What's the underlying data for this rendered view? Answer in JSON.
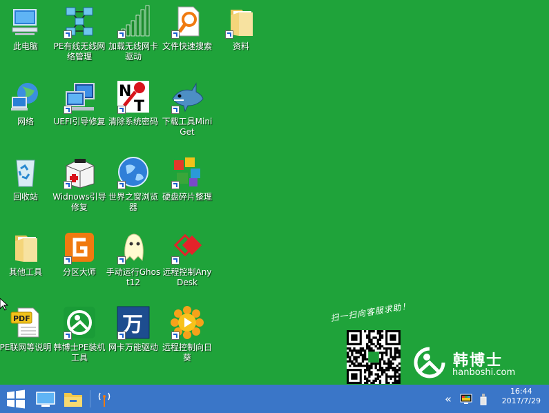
{
  "desktop": {
    "icons": [
      {
        "label": "此电脑",
        "icon": "computer-icon",
        "shortcut": false
      },
      {
        "label": "PE有线无线网络管理",
        "icon": "network-manager-icon",
        "shortcut": true
      },
      {
        "label": "加载无线网卡驱动",
        "icon": "wireless-signal-icon",
        "shortcut": true
      },
      {
        "label": "文件快速搜索",
        "icon": "file-search-icon",
        "shortcut": true
      },
      {
        "label": "资料",
        "icon": "folder-icon",
        "shortcut": true
      },
      {
        "label": "网络",
        "icon": "network-globe-icon",
        "shortcut": false
      },
      {
        "label": "UEFI引导修复",
        "icon": "uefi-repair-icon",
        "shortcut": true
      },
      {
        "label": "清除系统密码",
        "icon": "password-clear-icon",
        "shortcut": true
      },
      {
        "label": "下载工具MiniGet",
        "icon": "shark-download-icon",
        "shortcut": true
      },
      {
        "label": "回收站",
        "icon": "recycle-bin-icon",
        "shortcut": false
      },
      {
        "label": "Widnows引导修复",
        "icon": "toolbox-icon",
        "shortcut": true
      },
      {
        "label": "世界之窗浏览器",
        "icon": "browser-globe-icon",
        "shortcut": true
      },
      {
        "label": "硬盘碎片整理",
        "icon": "defrag-icon",
        "shortcut": true
      },
      {
        "label": "其他工具",
        "icon": "folder-icon",
        "shortcut": false
      },
      {
        "label": "分区大师",
        "icon": "partition-icon",
        "shortcut": true
      },
      {
        "label": "手动运行Ghost12",
        "icon": "ghost-icon",
        "shortcut": true
      },
      {
        "label": "远程控制AnyDesk",
        "icon": "anydesk-icon",
        "shortcut": true
      },
      {
        "label": "PE联网等说明",
        "icon": "pdf-icon",
        "shortcut": false
      },
      {
        "label": "韩博士PE装机工具",
        "icon": "hanboshi-installer-icon",
        "shortcut": true
      },
      {
        "label": "网卡万能驱动",
        "icon": "wan-driver-icon",
        "shortcut": true
      },
      {
        "label": "远程控制向日葵",
        "icon": "sunflower-icon",
        "shortcut": true
      }
    ],
    "promo": {
      "scan_text": "扫一扫向客服求助！",
      "brand_name": "韩博士",
      "brand_url": "hanboshi.com"
    }
  },
  "taskbar": {
    "time": "16:44",
    "date": "2017/7/29",
    "tray_chevron": "«",
    "accent": "#3a76c8"
  }
}
